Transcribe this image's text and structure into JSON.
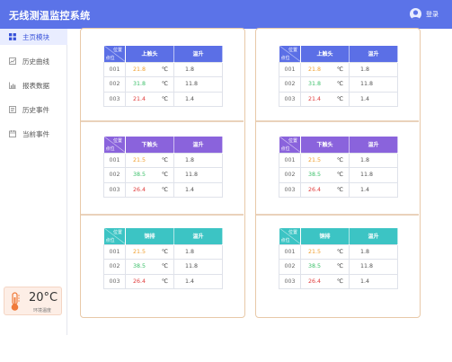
{
  "app": {
    "title": "无线测温监控系统",
    "user_label": "登录"
  },
  "sidebar": {
    "items": [
      {
        "label": "主页模块",
        "icon": "grid-icon",
        "active": true
      },
      {
        "label": "历史曲线",
        "icon": "chart-icon",
        "active": false
      },
      {
        "label": "报表数据",
        "icon": "report-icon",
        "active": false
      },
      {
        "label": "历史事件",
        "icon": "history-icon",
        "active": false
      },
      {
        "label": "当前事件",
        "icon": "event-icon",
        "active": false
      }
    ]
  },
  "ambient": {
    "value": "20°C",
    "label": "环境温度"
  },
  "table_header": {
    "position": "位置",
    "point": "点位",
    "rise": "温升"
  },
  "colors": {
    "orange": "#f0a030",
    "green": "#3cc06a",
    "red": "#e03c3c",
    "blue": "#5b6fe6",
    "purple": "#8a63dc",
    "teal": "#3cc4c4"
  },
  "panels": [
    {
      "name": "left",
      "tables": [
        {
          "title": "上触头",
          "rows": [
            {
              "id": "001",
              "temp": "21.8",
              "unit": "℃",
              "rise": "1.8"
            },
            {
              "id": "002",
              "temp": "31.8",
              "unit": "℃",
              "rise": "11.8"
            },
            {
              "id": "003",
              "temp": "21.4",
              "unit": "℃",
              "rise": "1.4"
            }
          ]
        },
        {
          "title": "下触头",
          "rows": [
            {
              "id": "001",
              "temp": "21.5",
              "unit": "℃",
              "rise": "1.8"
            },
            {
              "id": "002",
              "temp": "38.5",
              "unit": "℃",
              "rise": "11.8"
            },
            {
              "id": "003",
              "temp": "26.4",
              "unit": "℃",
              "rise": "1.4"
            }
          ]
        },
        {
          "title": "铜排",
          "rows": [
            {
              "id": "001",
              "temp": "21.5",
              "unit": "℃",
              "rise": "1.8"
            },
            {
              "id": "002",
              "temp": "38.5",
              "unit": "℃",
              "rise": "11.8"
            },
            {
              "id": "003",
              "temp": "26.4",
              "unit": "℃",
              "rise": "1.4"
            }
          ]
        }
      ]
    },
    {
      "name": "right",
      "tables": [
        {
          "title": "上触头",
          "rows": [
            {
              "id": "001",
              "temp": "21.8",
              "unit": "℃",
              "rise": "1.8"
            },
            {
              "id": "002",
              "temp": "31.8",
              "unit": "℃",
              "rise": "11.8"
            },
            {
              "id": "003",
              "temp": "21.4",
              "unit": "℃",
              "rise": "1.4"
            }
          ]
        },
        {
          "title": "下触头",
          "rows": [
            {
              "id": "001",
              "temp": "21.5",
              "unit": "℃",
              "rise": "1.8"
            },
            {
              "id": "002",
              "temp": "38.5",
              "unit": "℃",
              "rise": "11.8"
            },
            {
              "id": "003",
              "temp": "26.4",
              "unit": "℃",
              "rise": "1.4"
            }
          ]
        },
        {
          "title": "铜排",
          "rows": [
            {
              "id": "001",
              "temp": "21.5",
              "unit": "℃",
              "rise": "1.8"
            },
            {
              "id": "002",
              "temp": "38.5",
              "unit": "℃",
              "rise": "11.8"
            },
            {
              "id": "003",
              "temp": "26.4",
              "unit": "℃",
              "rise": "1.4"
            }
          ]
        }
      ]
    }
  ]
}
